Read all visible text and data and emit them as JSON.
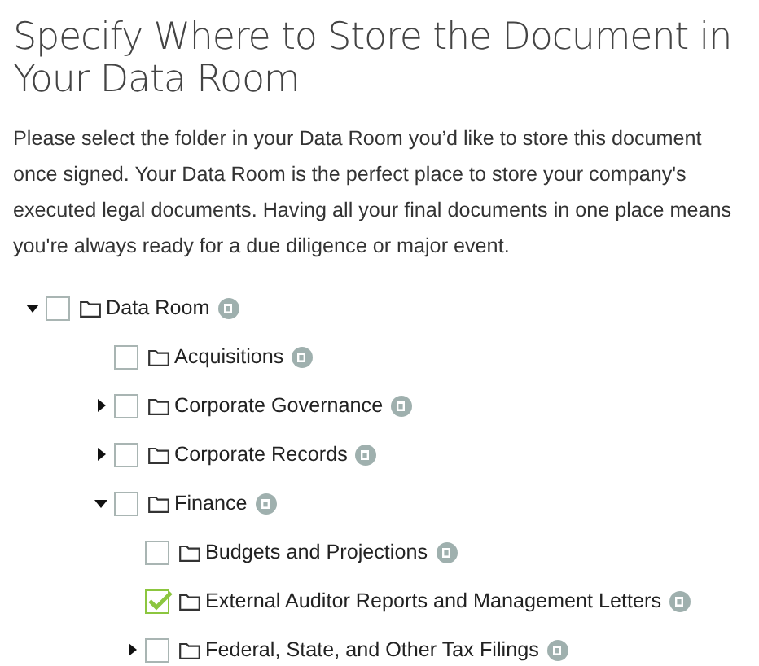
{
  "title": "Specify Where to Store the Document in Your Data Room",
  "description": "Please select the folder in your Data Room you’d like to store this document once signed. Your Data Room is the perfect place to store your company's executed legal documents. Having all your final documents in one place means you're always ready for a due diligence or major event.",
  "folders": [
    {
      "label": "Data Room",
      "checked": false,
      "expanded": true,
      "children": [
        {
          "label": "Acquisitions",
          "checked": false
        },
        {
          "label": "Corporate Governance",
          "checked": false,
          "expanded": false
        },
        {
          "label": "Corporate Records",
          "checked": false,
          "expanded": false
        },
        {
          "label": "Finance",
          "checked": false,
          "expanded": true,
          "children": [
            {
              "label": "Budgets and Projections",
              "checked": false
            },
            {
              "label": "External Auditor Reports and Management Letters",
              "checked": true
            },
            {
              "label": "Federal, State, and Other Tax Filings",
              "checked": false,
              "expanded": false
            }
          ]
        }
      ]
    }
  ]
}
